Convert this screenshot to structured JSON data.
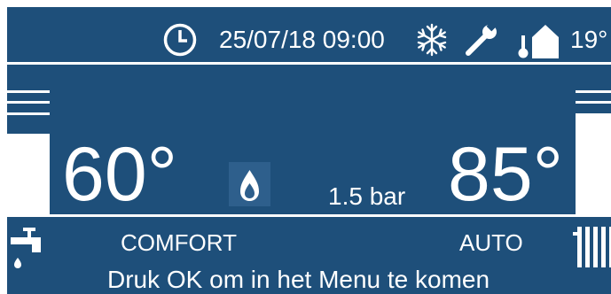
{
  "status_bar": {
    "datetime": "25/07/18 09:00",
    "outside_temp": "19°",
    "icons": [
      "clock-icon",
      "snowflake-icon",
      "wrench-icon",
      "outdoor-thermometer-icon"
    ]
  },
  "dhw": {
    "temperature": "60°",
    "mode": "COMFORT",
    "icon": "tap-icon",
    "level_fraction": 0.6
  },
  "heating": {
    "temperature": "85°",
    "mode": "AUTO",
    "icon": "radiator-icon",
    "level_fraction": 0.75
  },
  "burner": {
    "icon": "flame-icon"
  },
  "pressure": "1.5 bar",
  "message": "Druk OK om in het Menu te komen",
  "colors": {
    "background": "#1e4f7a",
    "foreground": "#ffffff",
    "flame_box": "#2e5f8c"
  }
}
